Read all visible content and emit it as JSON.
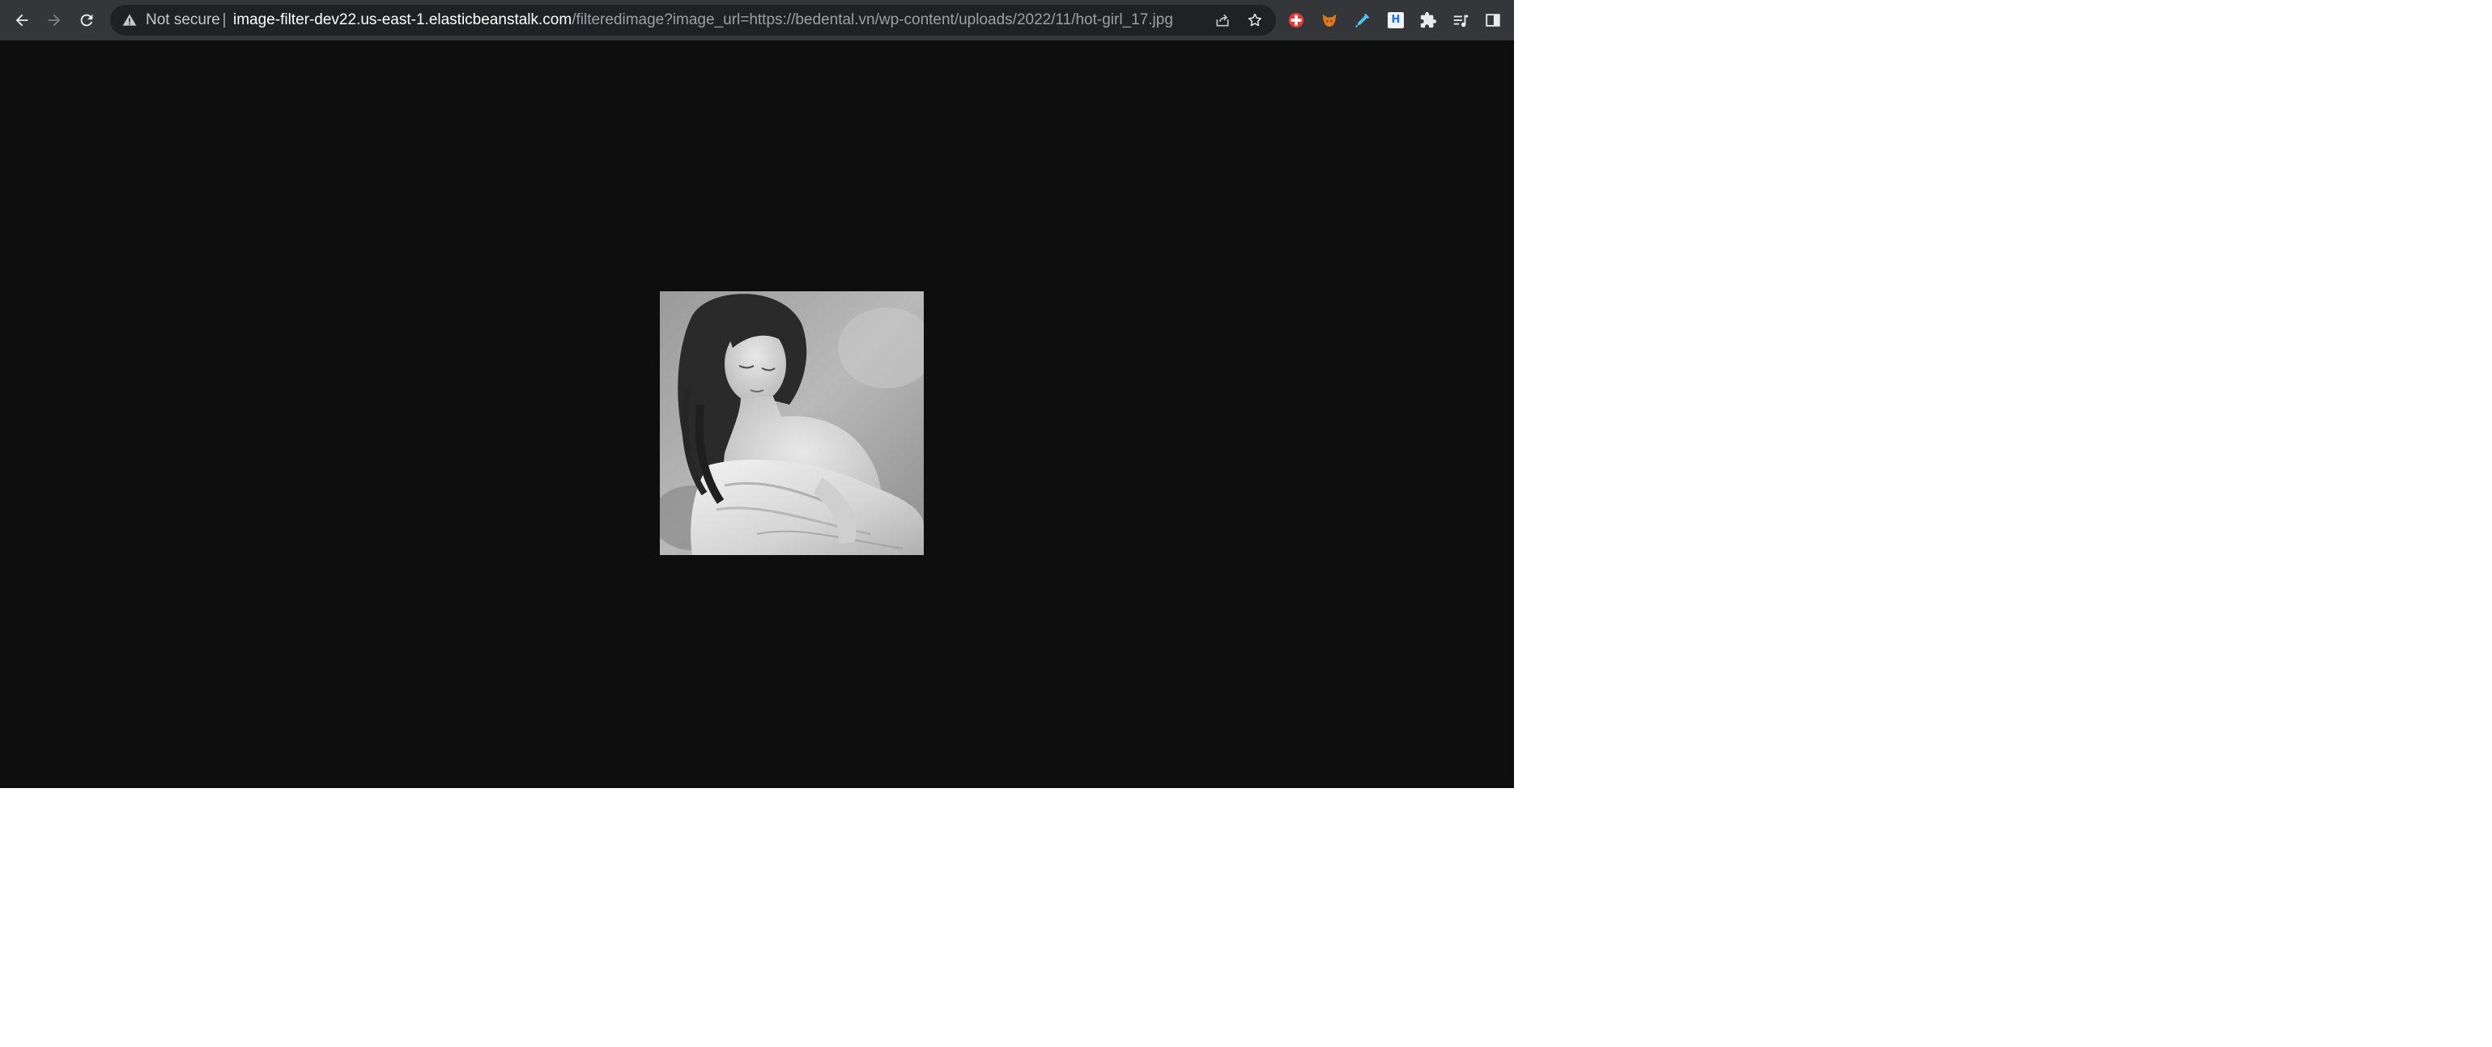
{
  "browser": {
    "toolbar": {
      "security_warning": "Not secure",
      "url_host": "image-filter-dev22.us-east-1.elasticbeanstalk.com",
      "url_path": "/filteredimage?image_url=https://bedental.vn/wp-content/uploads/2022/11/hot-girl_17.jpg",
      "nav_icons": [
        "back-arrow-icon",
        "forward-arrow-icon",
        "reload-icon"
      ],
      "omnibox_icons": [
        "warning-triangle-icon",
        "share-icon",
        "bookmark-star-icon"
      ],
      "extension_icons": [
        "red-cross-extension-icon",
        "fox-extension-icon",
        "dropper-extension-icon",
        "h-extension-icon",
        "puzzle-extensions-icon",
        "media-control-icon",
        "side-panel-icon"
      ],
      "extension_h_letter": "H"
    },
    "page": {
      "image": {
        "description": "grayscale photo",
        "filter": "grayscale"
      }
    },
    "colors": {
      "toolbar_bg": "#35363a",
      "omnibox_bg": "#202124",
      "page_bg": "#0e0e0e",
      "url_host_color": "#ffffff",
      "url_path_color": "#9aa0a6"
    }
  }
}
